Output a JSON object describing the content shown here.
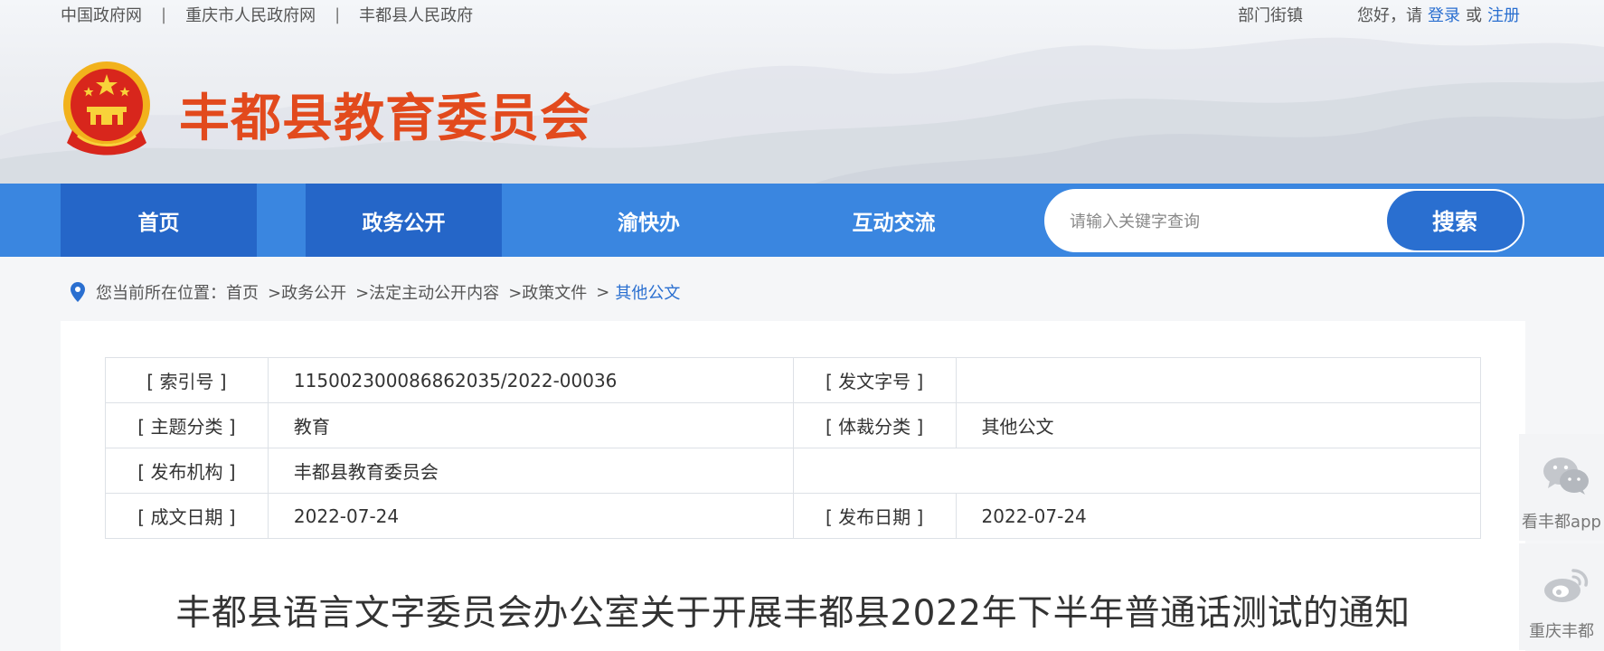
{
  "header": {
    "top_links": [
      "中国政府网",
      "重庆市人民政府网",
      "丰都县人民政府"
    ],
    "separator": "|",
    "dept_link": "部门街镇",
    "greeting": "您好，请",
    "login": "登录",
    "or": "或",
    "register": "注册",
    "site_title": "丰都县教育委员会"
  },
  "nav": {
    "items": [
      "首页",
      "政务公开",
      "渝快办",
      "互动交流"
    ],
    "search_placeholder": "请输入关键字查询",
    "search_button": "搜索",
    "colors": {
      "bar": "#3a86e0",
      "active": "#2566c8"
    }
  },
  "breadcrumb": {
    "prefix": "您当前所在位置：",
    "items": [
      "首页",
      ">政务公开",
      ">法定主动公开内容",
      ">政策文件"
    ],
    "arrow": ">",
    "current": "其他公文"
  },
  "meta": {
    "index_label": "[ 索引号 ]",
    "index_value": "11500230008686203​5/2022-00036",
    "doc_no_label": "[ 发文字号 ]",
    "doc_no_value": "",
    "topic_label": "[ 主题分类 ]",
    "topic_value": "教育",
    "genre_label": "[ 体裁分类 ]",
    "genre_value": "其他公文",
    "org_label": "[ 发布机构 ]",
    "org_value": "丰都县教育委员会",
    "written_label": "[ 成文日期 ]",
    "written_value": "2022-07-24",
    "publish_label": "[ 发布日期 ]",
    "publish_value": "2022-07-24"
  },
  "document": {
    "title": "丰都县语言文字委员会办公室关于开展丰都县2022年下半年普通话测试的通知"
  },
  "float": {
    "wechat_label": "看丰都app",
    "weibo_label": "重庆丰都"
  },
  "colors": {
    "title": "#e24a1d",
    "link_blue": "#2a6fd0"
  }
}
